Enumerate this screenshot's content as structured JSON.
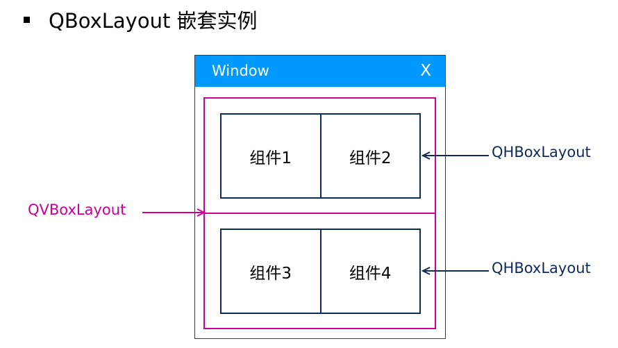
{
  "slide": {
    "title": "QBoxLayout 嵌套实例"
  },
  "window": {
    "title": "Window",
    "close_label": "X"
  },
  "layouts": {
    "top_row": [
      "组件1",
      "组件2"
    ],
    "bottom_row": [
      "组件3",
      "组件4"
    ]
  },
  "annotations": {
    "top_hbox": "QHBoxLayout",
    "bottom_hbox": "QHBoxLayout",
    "vbox": "QVBoxLayout"
  },
  "colors": {
    "titlebar": "#0099ff",
    "vbox_outline": "#cc0099",
    "hbox_outline": "#0e2a5a"
  }
}
